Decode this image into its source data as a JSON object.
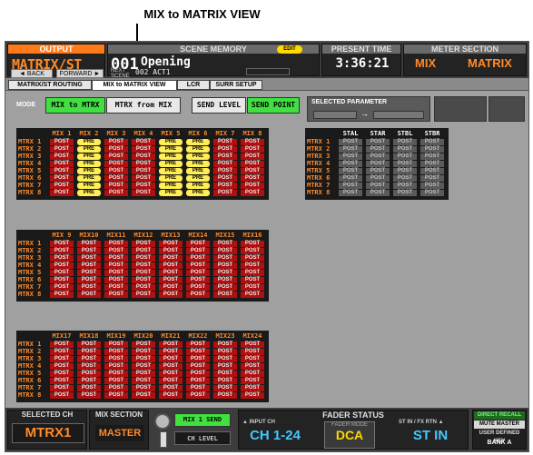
{
  "callout": {
    "label": "MIX to MATRIX VIEW"
  },
  "output": {
    "header": "OUTPUT",
    "value": "MATRIX/ST",
    "back": "◄ BACK",
    "forward": "FORWARD ►"
  },
  "scene_memory": {
    "header": "SCENE MEMORY",
    "edit_badge": "EDIT",
    "number": "001",
    "title": "Opening",
    "next_label": "NEXT SCENE",
    "next_value": "002 ACT1"
  },
  "present_time": {
    "header": "PRESENT TIME",
    "value": "3:36:21"
  },
  "meter_section": {
    "header": "METER SECTION",
    "left": "MIX",
    "right": "MATRIX"
  },
  "tabs": [
    "MATRIX/ST ROUTING",
    "MIX to MATRIX VIEW",
    "LCR",
    "SURR SETUP"
  ],
  "active_tab": 1,
  "mode": {
    "label": "MODE",
    "mix_to_mtrx": "MIX to MTRX",
    "mtrx_from_mix": "MTRX from MIX",
    "send_level": "SEND LEVEL",
    "send_point": "SEND POINT"
  },
  "selected_parameter": {
    "label": "SELECTED PARAMETER",
    "arrow": "→"
  },
  "row_labels": [
    "MTRX 1",
    "MTRX 2",
    "MTRX 3",
    "MTRX 4",
    "MTRX 5",
    "MTRX 6",
    "MTRX 7",
    "MTRX 8"
  ],
  "grids": [
    {
      "columns": [
        "MIX 1",
        "MIX 2",
        "MIX 3",
        "MIX 4",
        "MIX 5",
        "MIX 6",
        "MIX 7",
        "MIX 8"
      ],
      "rows": [
        [
          "POST",
          "PRE",
          "POST",
          "POST",
          "PRE",
          "PRE",
          "POST",
          "POST"
        ],
        [
          "POST",
          "PRE",
          "POST",
          "POST",
          "PRE",
          "PRE",
          "POST",
          "POST"
        ],
        [
          "POST",
          "PRE",
          "POST",
          "POST",
          "PRE",
          "PRE",
          "POST",
          "POST"
        ],
        [
          "POST",
          "PRE",
          "POST",
          "POST",
          "PRE",
          "PRE",
          "POST",
          "POST"
        ],
        [
          "POST",
          "PRE",
          "POST",
          "POST",
          "PRE",
          "PRE",
          "POST",
          "POST"
        ],
        [
          "POST",
          "PRE",
          "POST",
          "POST",
          "PRE",
          "PRE",
          "POST",
          "POST"
        ],
        [
          "POST",
          "PRE",
          "POST",
          "POST",
          "PRE",
          "PRE",
          "POST",
          "POST"
        ],
        [
          "POST",
          "PRE",
          "POST",
          "POST",
          "PRE",
          "PRE",
          "POST",
          "POST"
        ]
      ]
    },
    {
      "columns": [
        "MIX 9",
        "MIX10",
        "MIX11",
        "MIX12",
        "MIX13",
        "MIX14",
        "MIX15",
        "MIX16"
      ],
      "rows": [
        [
          "POST",
          "POST",
          "POST",
          "POST",
          "POST",
          "POST",
          "POST",
          "POST"
        ],
        [
          "POST",
          "POST",
          "POST",
          "POST",
          "POST",
          "POST",
          "POST",
          "POST"
        ],
        [
          "POST",
          "POST",
          "POST",
          "POST",
          "POST",
          "POST",
          "POST",
          "POST"
        ],
        [
          "POST",
          "POST",
          "POST",
          "POST",
          "POST",
          "POST",
          "POST",
          "POST"
        ],
        [
          "POST",
          "POST",
          "POST",
          "POST",
          "POST",
          "POST",
          "POST",
          "POST"
        ],
        [
          "POST",
          "POST",
          "POST",
          "POST",
          "POST",
          "POST",
          "POST",
          "POST"
        ],
        [
          "POST",
          "POST",
          "POST",
          "POST",
          "POST",
          "POST",
          "POST",
          "POST"
        ],
        [
          "POST",
          "POST",
          "POST",
          "POST",
          "POST",
          "POST",
          "POST",
          "POST"
        ]
      ]
    },
    {
      "columns": [
        "MIX17",
        "MIX18",
        "MIX19",
        "MIX20",
        "MIX21",
        "MIX22",
        "MIX23",
        "MIX24"
      ],
      "rows": [
        [
          "POST",
          "POST",
          "POST",
          "POST",
          "POST",
          "POST",
          "POST",
          "POST"
        ],
        [
          "POST",
          "POST",
          "POST",
          "POST",
          "POST",
          "POST",
          "POST",
          "POST"
        ],
        [
          "POST",
          "POST",
          "POST",
          "POST",
          "POST",
          "POST",
          "POST",
          "POST"
        ],
        [
          "POST",
          "POST",
          "POST",
          "POST",
          "POST",
          "POST",
          "POST",
          "POST"
        ],
        [
          "POST",
          "POST",
          "POST",
          "POST",
          "POST",
          "POST",
          "POST",
          "POST"
        ],
        [
          "POST",
          "POST",
          "POST",
          "POST",
          "POST",
          "POST",
          "POST",
          "POST"
        ],
        [
          "POST",
          "POST",
          "POST",
          "POST",
          "POST",
          "POST",
          "POST",
          "POST"
        ],
        [
          "POST",
          "POST",
          "POST",
          "POST",
          "POST",
          "POST",
          "POST",
          "POST"
        ]
      ]
    }
  ],
  "st_grid": {
    "columns": [
      "STAL",
      "STAR",
      "STBL",
      "STBR"
    ],
    "rows": [
      [
        "POST",
        "POST",
        "POST",
        "POST"
      ],
      [
        "POST",
        "POST",
        "POST",
        "POST"
      ],
      [
        "POST",
        "POST",
        "POST",
        "POST"
      ],
      [
        "POST",
        "POST",
        "POST",
        "POST"
      ],
      [
        "POST",
        "POST",
        "POST",
        "POST"
      ],
      [
        "POST",
        "POST",
        "POST",
        "POST"
      ],
      [
        "POST",
        "POST",
        "POST",
        "POST"
      ],
      [
        "POST",
        "POST",
        "POST",
        "POST"
      ]
    ]
  },
  "bottom": {
    "selected_ch_header": "SELECTED CH",
    "selected_ch": "MTRX1",
    "mix_section_header": "MIX SECTION",
    "mix_section": "MASTER",
    "mix1_send": "MIX 1 SEND",
    "ch_level": "CH LEVEL",
    "fader_status": "FADER STATUS",
    "input_ch_label": "▲ INPUT CH",
    "input_ch": "CH 1-24",
    "fader_mode_label": "FADER MODE",
    "fader_mode": "DCA",
    "st_in_label": "ST IN / FX RTN ▲",
    "st_in": "ST IN",
    "direct_recall": "DIRECT RECALL",
    "mute_master": "MUTE MASTER",
    "user_defined": "USER DEFINED KEY",
    "bank": "BANK A"
  },
  "colors": {
    "accent": "#ff8a2a",
    "post": "#b01010",
    "pre": "#ffee55",
    "on": "#3fe03f"
  }
}
